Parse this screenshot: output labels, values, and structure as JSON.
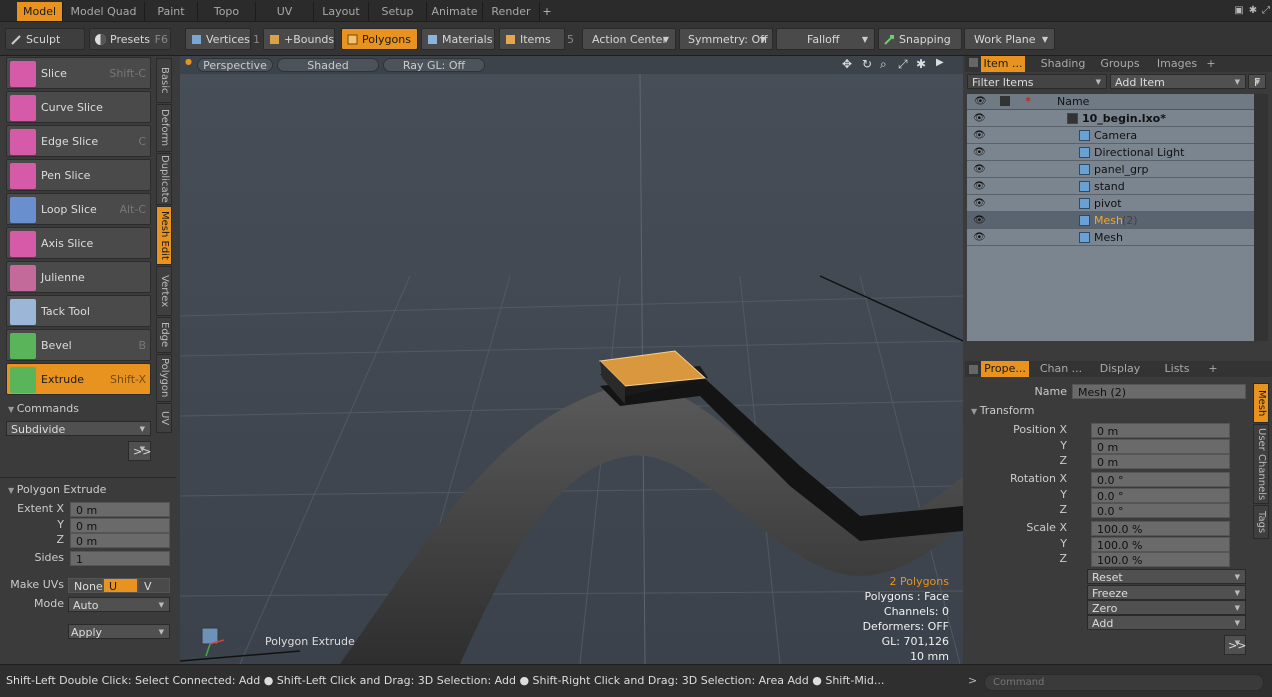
{
  "top_tabs": [
    "Model",
    "Model Quad",
    "Paint",
    "Topo",
    "UV",
    "Layout",
    "Setup",
    "Animate",
    "Render",
    "+"
  ],
  "toolbar": {
    "sculpt": "Sculpt",
    "presets": "Presets",
    "presets_key": "F6",
    "vertices": "Vertices",
    "vertices_num": "1",
    "bounds": "+Bounds",
    "polygons": "Polygons",
    "materials": "Materials",
    "items": "Items",
    "items_num": "5",
    "action_center": "Action Center",
    "symmetry": "Symmetry: Off",
    "falloff": "Falloff",
    "snapping": "Snapping",
    "work_plane": "Work Plane"
  },
  "tools": [
    {
      "label": "Slice",
      "shortcut": "Shift-C",
      "color": "#d55aa8"
    },
    {
      "label": "Curve Slice",
      "shortcut": "",
      "color": "#d55aa8"
    },
    {
      "label": "Edge Slice",
      "shortcut": "C",
      "color": "#d55aa8"
    },
    {
      "label": "Pen Slice",
      "shortcut": "",
      "color": "#d55aa8"
    },
    {
      "label": "Loop Slice",
      "shortcut": "Alt-C",
      "color": "#6a8fcf"
    },
    {
      "label": "Axis Slice",
      "shortcut": "",
      "color": "#d55aa8"
    },
    {
      "label": "Julienne",
      "shortcut": "",
      "color": "#c46a9a"
    },
    {
      "label": "Tack Tool",
      "shortcut": "",
      "color": "#9bb6d6"
    },
    {
      "label": "Bevel",
      "shortcut": "B",
      "color": "#5ab55a"
    },
    {
      "label": "Extrude",
      "shortcut": "Shift-X",
      "color": "#5ab55a"
    }
  ],
  "side_tabs": [
    "Basic",
    "Deform",
    "Duplicate",
    "Mesh Edit",
    "Vertex",
    "Edge",
    "Polygon",
    "UV"
  ],
  "commands": {
    "header": "Commands",
    "subdivide": "Subdivide",
    "more": ">>"
  },
  "polygon_extrude": {
    "header": "Polygon Extrude",
    "extent_label": "Extent X",
    "y_label": "Y",
    "z_label": "Z",
    "extent_x": "0 m",
    "extent_y": "0 m",
    "extent_z": "0 m",
    "sides_label": "Sides",
    "sides": "1",
    "make_uvs_label": "Make UVs",
    "uv_none": "None",
    "uv_u": "U",
    "uv_v": "V",
    "mode_label": "Mode",
    "mode": "Auto",
    "apply": "Apply"
  },
  "viewport": {
    "perspective": "Perspective",
    "shaded": "Shaded",
    "raygl": "Ray GL: Off",
    "tool_label": "Polygon Extrude",
    "info": {
      "polys": "2 Polygons",
      "poly_face": "Polygons : Face",
      "channels": "Channels: 0",
      "deformers": "Deformers: OFF",
      "gl": "GL: 701,126",
      "scale": "10 mm"
    }
  },
  "item_panel": {
    "tabs": [
      "Item ...",
      "Shading",
      "Groups",
      "Images",
      "+"
    ],
    "filter": "Filter Items",
    "add_item": "Add Item",
    "add_key": "F",
    "name_col": "Name",
    "items": [
      {
        "name": "10_begin.lxo*",
        "indent": 0
      },
      {
        "name": "Camera",
        "indent": 1
      },
      {
        "name": "Directional Light",
        "indent": 1
      },
      {
        "name": "panel_grp",
        "indent": 1
      },
      {
        "name": "stand",
        "indent": 1
      },
      {
        "name": "pivot",
        "indent": 1
      },
      {
        "name": "Mesh",
        "indent": 1,
        "suffix": "(2)",
        "selected": true
      },
      {
        "name": "Mesh",
        "indent": 1
      }
    ]
  },
  "properties": {
    "tabs": [
      "Prope...",
      "Chan ...",
      "Display",
      "Lists",
      "+"
    ],
    "name_label": "Name",
    "name": "Mesh (2)",
    "transform": "Transform",
    "pos_label": "Position X",
    "px": "0 m",
    "py": "0 m",
    "pz": "0 m",
    "rot_label": "Rotation X",
    "rx": "0.0 °",
    "ry": "0.0 °",
    "rz": "0.0 °",
    "scale_label": "Scale X",
    "sx": "100.0 %",
    "sy": "100.0 %",
    "sz": "100.0 %",
    "y": "Y",
    "z": "Z",
    "reset": "Reset",
    "freeze": "Freeze",
    "zero": "Zero",
    "add": "Add",
    "more": ">>",
    "side_tabs": [
      "Mesh",
      "User Channels",
      "Tags"
    ]
  },
  "status": {
    "text": "Shift-Left Double Click: Select Connected: Add ● Shift-Left Click and Drag: 3D Selection: Add ● Shift-Right Click and Drag: 3D Selection: Area Add ● Shift-Mid...",
    "cmd_prompt": ">",
    "cmd_placeholder": "Command"
  }
}
